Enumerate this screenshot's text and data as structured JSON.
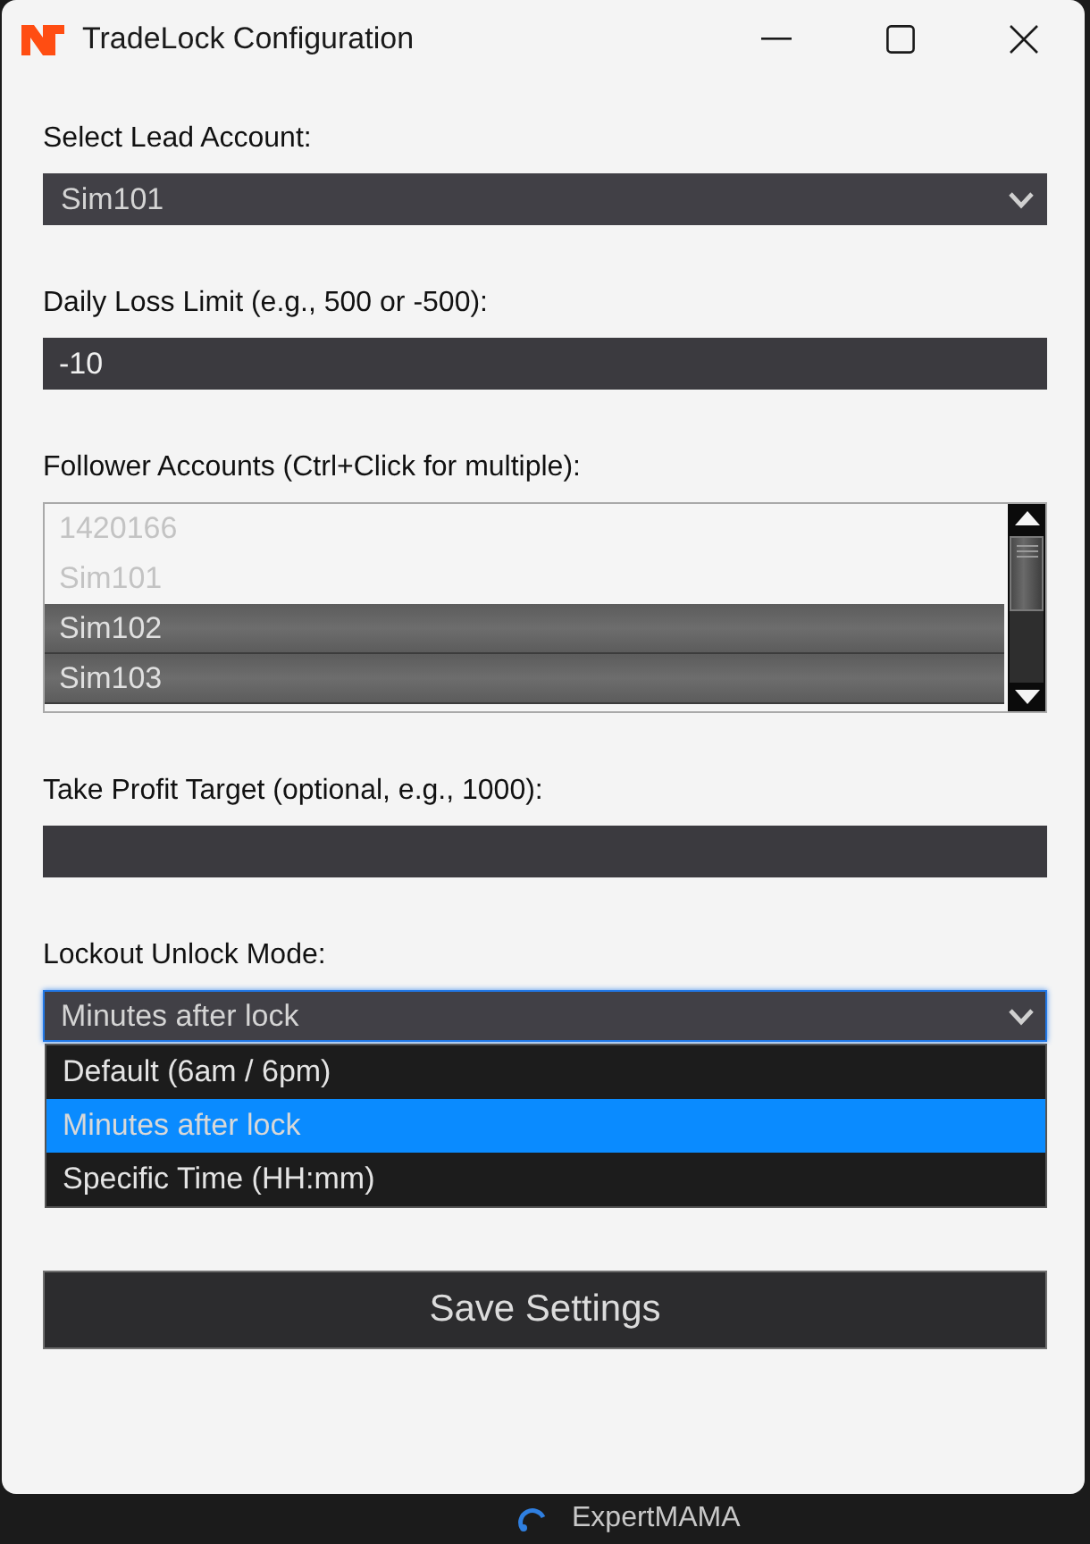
{
  "window": {
    "title": "TradeLock Configuration"
  },
  "fields": [
    {
      "kind": "combo",
      "label": "Select Lead Account:",
      "value": "Sim101",
      "expanded": false
    },
    {
      "kind": "text",
      "label": "Daily Loss Limit (e.g., 500 or -500):",
      "value": "-10"
    },
    {
      "kind": "list",
      "label": "Follower Accounts (Ctrl+Click for multiple):",
      "items": [
        {
          "text": "1420166",
          "selected": false
        },
        {
          "text": "Sim101",
          "selected": false
        },
        {
          "text": "Sim102",
          "selected": true
        },
        {
          "text": "Sim103",
          "selected": true
        }
      ]
    },
    {
      "kind": "text",
      "label": "Take Profit Target (optional, e.g., 1000):"
    },
    {
      "kind": "combo",
      "label": "Lockout Unlock Mode:",
      "value": "Minutes after lock",
      "expanded": true,
      "options": [
        {
          "text": "Default (6am / 6pm)",
          "selected": false
        },
        {
          "text": "Minutes after lock",
          "selected": true
        },
        {
          "text": "Specific Time (HH:mm)",
          "selected": false
        }
      ]
    }
  ],
  "save_button": {
    "label": "Save Settings"
  },
  "taskbar": {
    "label": "ExpertMAMA"
  }
}
